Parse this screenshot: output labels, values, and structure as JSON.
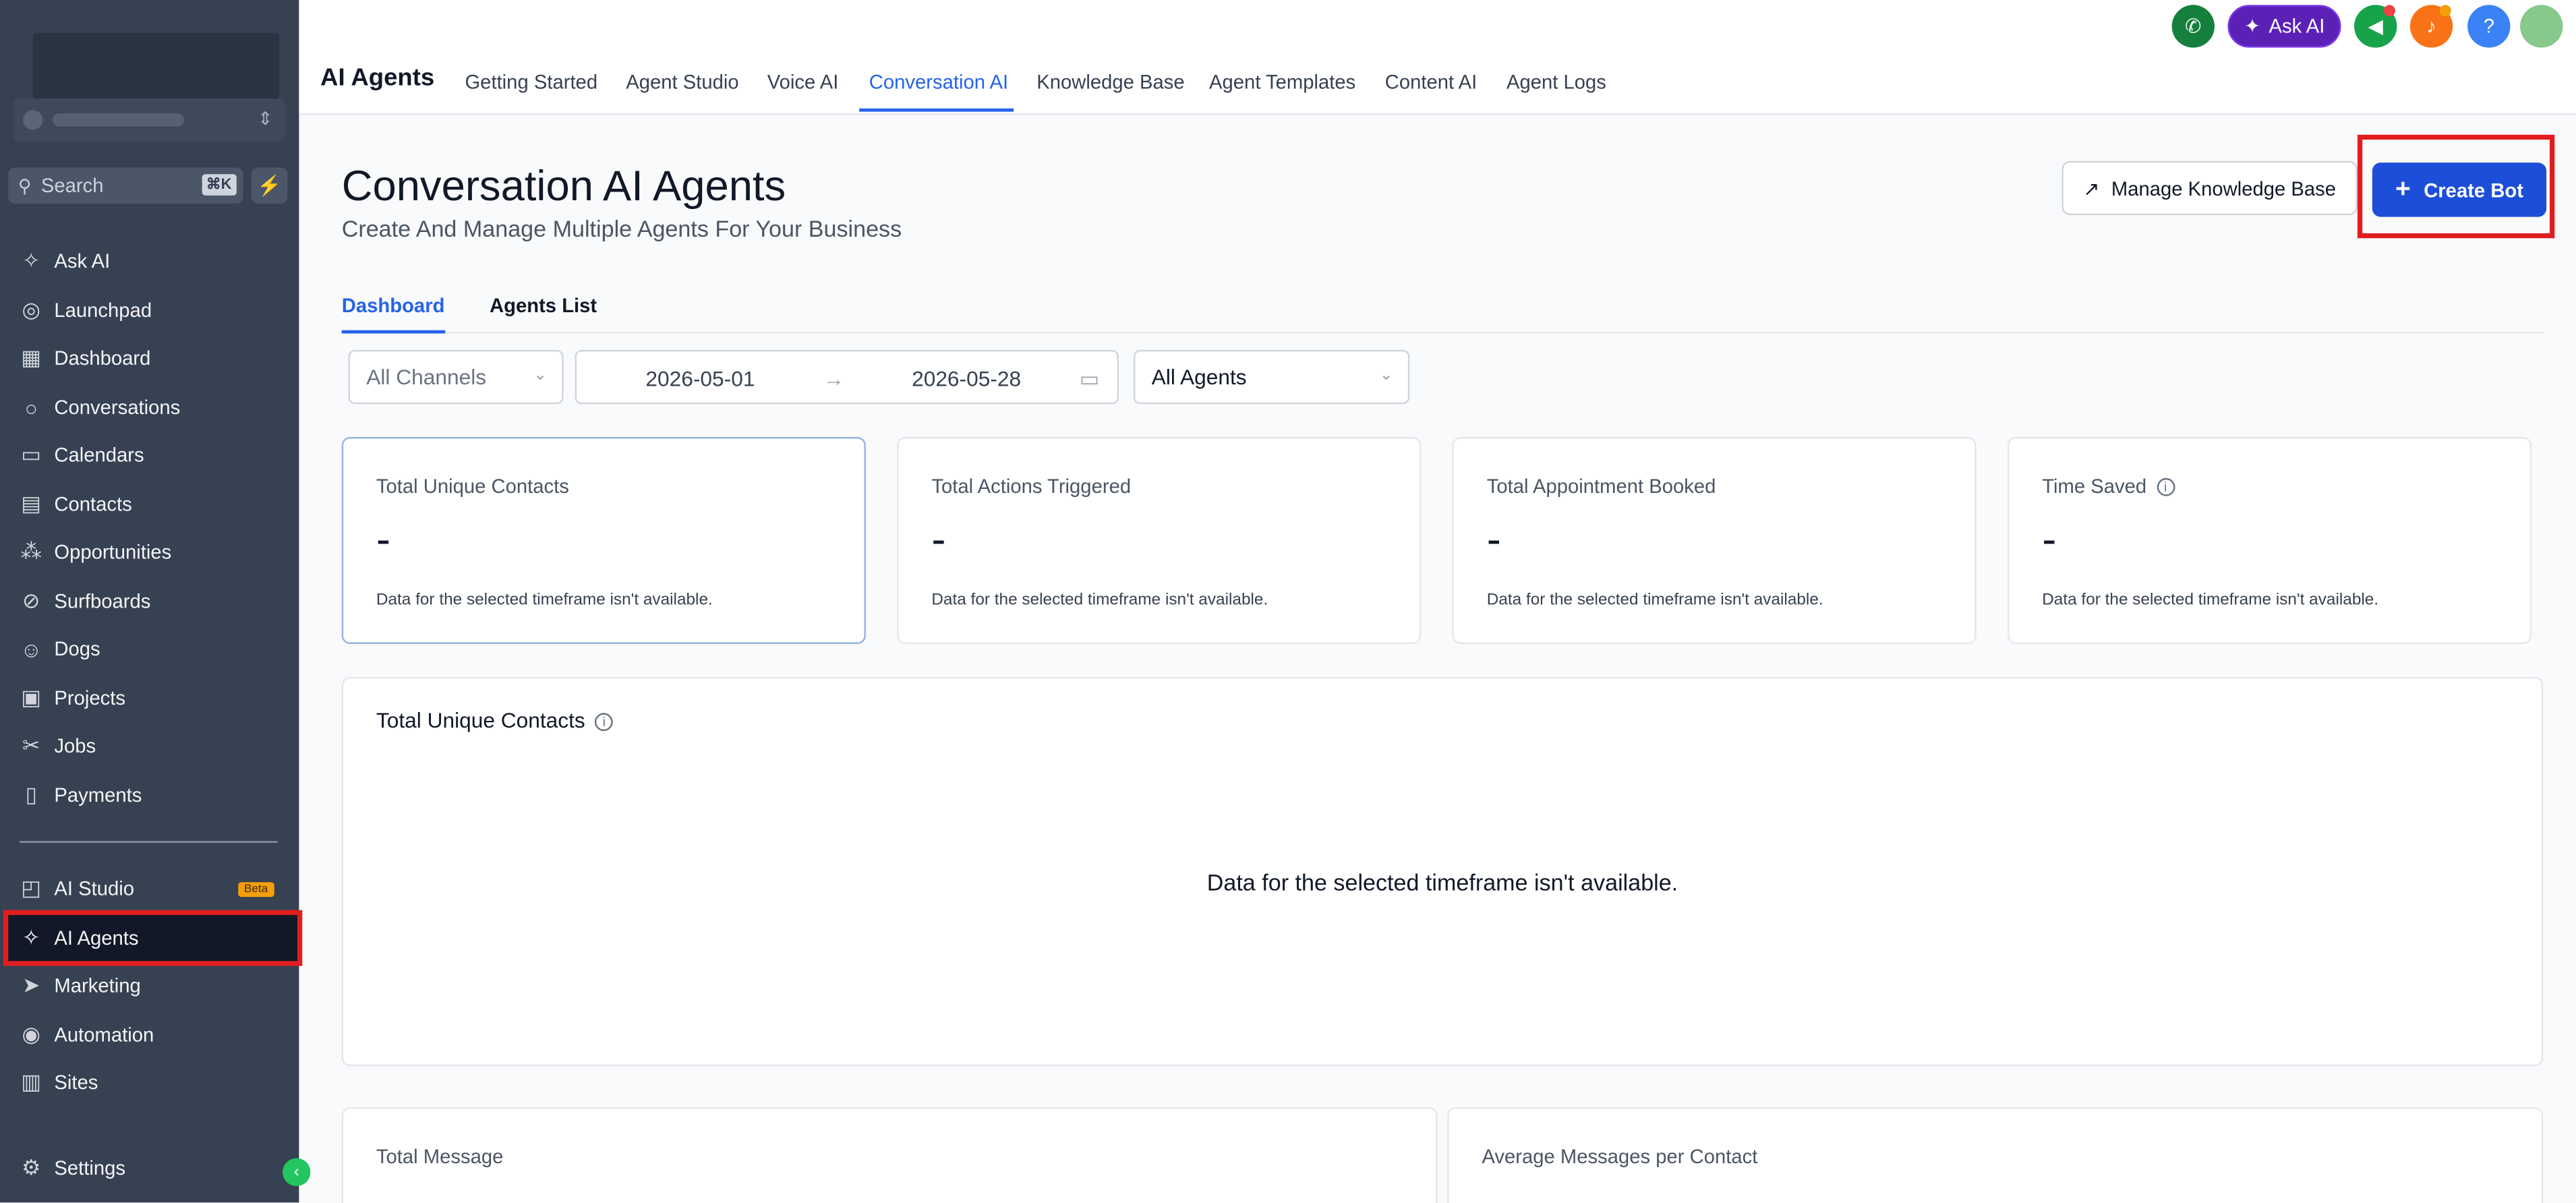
{
  "sidebar": {
    "search_placeholder": "Search",
    "search_shortcut": "⌘K",
    "items": [
      {
        "label": "Ask AI"
      },
      {
        "label": "Launchpad"
      },
      {
        "label": "Dashboard"
      },
      {
        "label": "Conversations"
      },
      {
        "label": "Calendars"
      },
      {
        "label": "Contacts"
      },
      {
        "label": "Opportunities"
      },
      {
        "label": "Surfboards"
      },
      {
        "label": "Dogs"
      },
      {
        "label": "Projects"
      },
      {
        "label": "Jobs"
      },
      {
        "label": "Payments"
      },
      {
        "label": "AI Studio",
        "badge": "Beta"
      },
      {
        "label": "AI Agents"
      },
      {
        "label": "Marketing"
      },
      {
        "label": "Automation"
      },
      {
        "label": "Sites"
      },
      {
        "label": "Settings"
      }
    ]
  },
  "topbar": {
    "title": "AI Agents",
    "tabs": [
      "Getting Started",
      "Agent Studio",
      "Voice AI",
      "Conversation AI",
      "Knowledge Base",
      "Agent Templates",
      "Content AI",
      "Agent Logs"
    ],
    "active_tab": "Conversation AI",
    "ask_ai_label": "Ask AI",
    "help_label": "?"
  },
  "page": {
    "title": "Conversation AI Agents",
    "subtitle": "Create And Manage Multiple Agents For Your Business",
    "manage_kb_label": "Manage Knowledge Base",
    "create_bot_label": "Create Bot",
    "subtabs": [
      "Dashboard",
      "Agents List"
    ],
    "filters": {
      "channels": "All Channels",
      "date_start": "2026-05-01",
      "date_end": "2026-05-28",
      "agents": "All Agents"
    },
    "cards": [
      {
        "title": "Total Unique Contacts",
        "value": "-",
        "note": "Data for the selected timeframe isn't available."
      },
      {
        "title": "Total Actions Triggered",
        "value": "-",
        "note": "Data for the selected timeframe isn't available."
      },
      {
        "title": "Total Appointment Booked",
        "value": "-",
        "note": "Data for the selected timeframe isn't available."
      },
      {
        "title": "Time Saved",
        "value": "-",
        "note": "Data for the selected timeframe isn't available."
      }
    ],
    "unique_panel": {
      "title": "Total Unique Contacts",
      "empty": "Data for the selected timeframe isn't available."
    },
    "total_message_title": "Total Message",
    "avg_messages_title": "Average Messages per Contact"
  }
}
